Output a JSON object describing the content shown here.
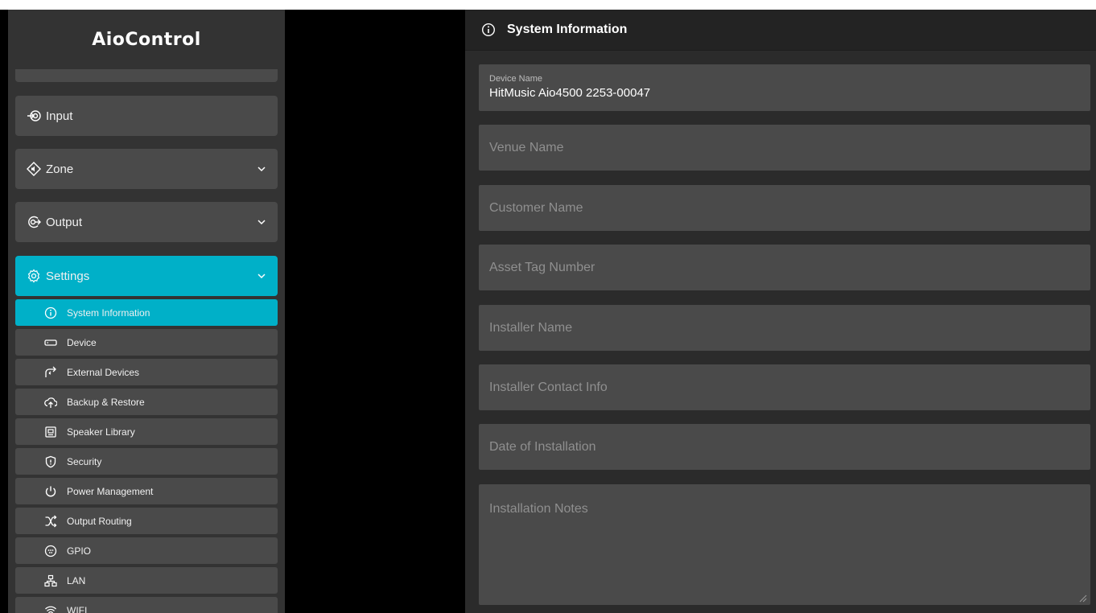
{
  "app": {
    "brand": "AioControl"
  },
  "sidebar": {
    "nav": [
      {
        "label": "Input",
        "icon": "input-icon"
      },
      {
        "label": "Zone",
        "icon": "zone-icon"
      },
      {
        "label": "Output",
        "icon": "output-icon"
      },
      {
        "label": "Settings",
        "icon": "gear-icon"
      }
    ],
    "settings_items": [
      {
        "label": "System Information",
        "icon": "info-icon"
      },
      {
        "label": "Device",
        "icon": "device-icon"
      },
      {
        "label": "External Devices",
        "icon": "external-devices-icon"
      },
      {
        "label": "Backup & Restore",
        "icon": "cloud-upload-icon"
      },
      {
        "label": "Speaker Library",
        "icon": "speaker-library-icon"
      },
      {
        "label": "Security",
        "icon": "shield-icon"
      },
      {
        "label": "Power Management",
        "icon": "power-icon"
      },
      {
        "label": "Output Routing",
        "icon": "routing-icon"
      },
      {
        "label": "GPIO",
        "icon": "gpio-icon"
      },
      {
        "label": "LAN",
        "icon": "lan-icon"
      },
      {
        "label": "WIFI",
        "icon": "wifi-icon"
      }
    ]
  },
  "main": {
    "title": "System Information",
    "device_name_label": "Device Name",
    "device_name_value": "HitMusic Aio4500 2253-00047",
    "placeholders": {
      "venue_name": "Venue Name",
      "customer_name": "Customer Name",
      "asset_tag": "Asset Tag Number",
      "installer_name": "Installer Name",
      "installer_contact": "Installer Contact Info",
      "installation_date": "Date of Installation",
      "installation_notes": "Installation Notes"
    }
  },
  "colors": {
    "accent": "#00b0c8",
    "panel": "#4a4a4a",
    "sidebar": "#333333"
  }
}
